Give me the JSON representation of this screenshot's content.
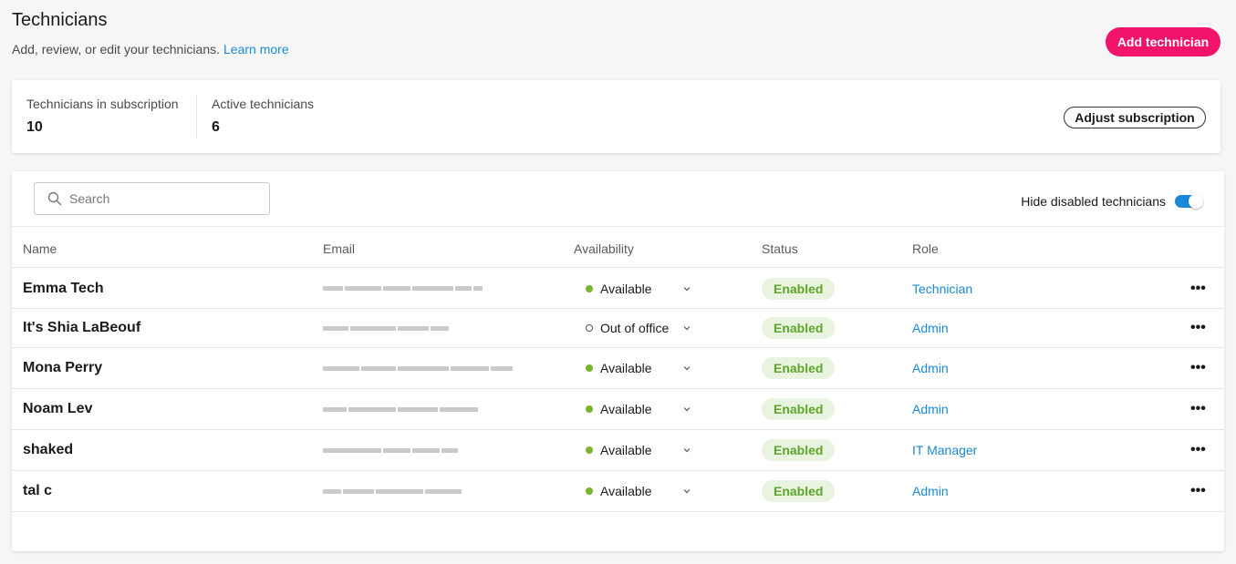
{
  "header": {
    "title": "Technicians",
    "subtitle": "Add, review, or edit your technicians.",
    "learn_more": "Learn more",
    "add_button": "Add technician"
  },
  "summary": {
    "subscription_label": "Technicians in subscription",
    "subscription_value": "10",
    "active_label": "Active technicians",
    "active_value": "6",
    "adjust_button": "Adjust subscription"
  },
  "toolbar": {
    "search_placeholder": "Search",
    "toggle_label": "Hide disabled technicians",
    "toggle_on": true
  },
  "table": {
    "columns": [
      "Name",
      "Email",
      "Availability",
      "Status",
      "Role"
    ],
    "rows": [
      {
        "name": "Emma Tech",
        "availability": "Available",
        "status": "Enabled",
        "role": "Technician"
      },
      {
        "name": "It's Shia LaBeouf",
        "availability": "Out of office",
        "status": "Enabled",
        "role": "Admin"
      },
      {
        "name": "Mona Perry",
        "availability": "Available",
        "status": "Enabled",
        "role": "Admin"
      },
      {
        "name": "Noam Lev",
        "availability": "Available",
        "status": "Enabled",
        "role": "Admin"
      },
      {
        "name": "shaked",
        "availability": "Available",
        "status": "Enabled",
        "role": "IT Manager"
      },
      {
        "name": "tal c",
        "availability": "Available",
        "status": "Enabled",
        "role": "Admin"
      }
    ]
  },
  "colors": {
    "accent": "#f2146b",
    "link": "#1a8ad6",
    "available": "#7ab32e",
    "enabled_bg": "#e8f4df",
    "enabled_text": "#5fa52b"
  },
  "icons": {
    "search": "search-icon",
    "chevron": "chevron-down-icon",
    "more": "more-horizontal-icon"
  },
  "more_glyph": "•••"
}
